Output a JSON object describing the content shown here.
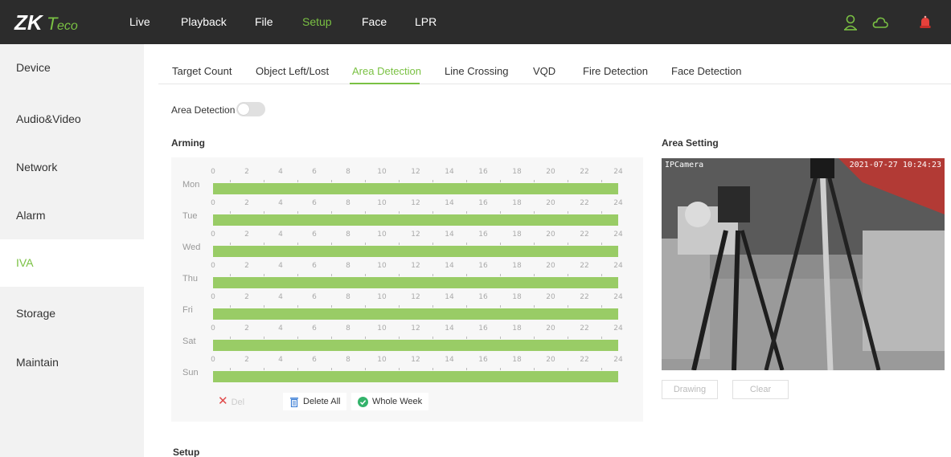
{
  "brand": {
    "logo_text": "ZKTeco",
    "accent_color": "#7ac143"
  },
  "topnav": {
    "items": [
      {
        "label": "Live"
      },
      {
        "label": "Playback"
      },
      {
        "label": "File"
      },
      {
        "label": "Setup",
        "active": true
      },
      {
        "label": "Face"
      },
      {
        "label": "LPR"
      }
    ],
    "icons": [
      "user-icon",
      "cloud-icon",
      "alarm-icon"
    ]
  },
  "sidebar": {
    "items": [
      {
        "label": "Device"
      },
      {
        "label": "Audio&Video"
      },
      {
        "label": "Network"
      },
      {
        "label": "Alarm"
      },
      {
        "label": "IVA",
        "active": true
      },
      {
        "label": "Storage"
      },
      {
        "label": "Maintain"
      }
    ]
  },
  "tabs": [
    {
      "label": "Target Count"
    },
    {
      "label": "Object Left/Lost"
    },
    {
      "label": "Area Detection",
      "active": true
    },
    {
      "label": "Line Crossing"
    },
    {
      "label": "VQD"
    },
    {
      "label": "Fire Detection"
    },
    {
      "label": "Face Detection"
    }
  ],
  "area_detection": {
    "label": "Area Detection",
    "enabled": false
  },
  "arming": {
    "title": "Arming",
    "hour_ticks": [
      "0",
      "2",
      "4",
      "6",
      "8",
      "10",
      "12",
      "14",
      "16",
      "18",
      "20",
      "22",
      "24"
    ],
    "days": [
      {
        "label": "Mon",
        "armed_from": 0,
        "armed_to": 24
      },
      {
        "label": "Tue",
        "armed_from": 0,
        "armed_to": 24
      },
      {
        "label": "Wed",
        "armed_from": 0,
        "armed_to": 24
      },
      {
        "label": "Thu",
        "armed_from": 0,
        "armed_to": 24
      },
      {
        "label": "Fri",
        "armed_from": 0,
        "armed_to": 24
      },
      {
        "label": "Sat",
        "armed_from": 0,
        "armed_to": 24
      },
      {
        "label": "Sun",
        "armed_from": 0,
        "armed_to": 24
      }
    ],
    "buttons": {
      "del": "Del",
      "delete_all": "Delete All",
      "whole_week": "Whole Week"
    }
  },
  "area_setting": {
    "title": "Area Setting",
    "osd_name": "IPCamera",
    "osd_time": "2021-07-27 10:24:23",
    "drawing_label": "Drawing",
    "clear_label": "Clear"
  },
  "setup_section": {
    "title": "Setup"
  }
}
